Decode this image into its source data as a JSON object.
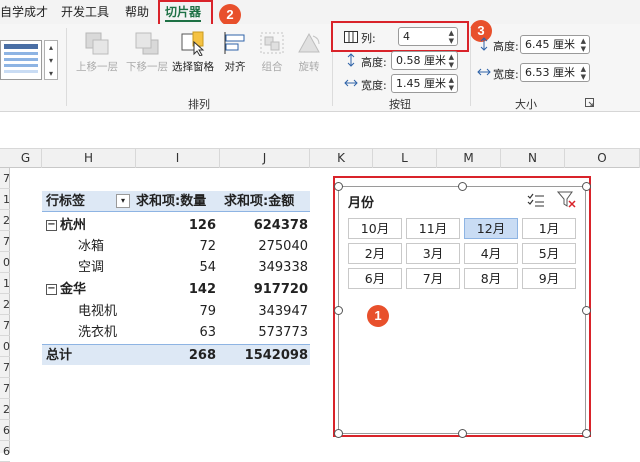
{
  "menu": {
    "tabs": [
      "自学成才",
      "开发工具",
      "帮助",
      "切片器"
    ],
    "active": "切片器"
  },
  "ribbon": {
    "arrange": {
      "label": "排列",
      "buttons": [
        "上移一层",
        "下移一层",
        "选择窗格",
        "对齐",
        "组合",
        "旋转"
      ]
    },
    "buttons_group": {
      "label": "按钮",
      "columns_label": "列:",
      "columns_value": "4",
      "height_label": "高度:",
      "height_value": "0.58 厘米",
      "width_label": "宽度:",
      "width_value": "1.45 厘米"
    },
    "size_group": {
      "label": "大小",
      "height_label": "高度:",
      "height_value": "6.45 厘米",
      "width_label": "宽度:",
      "width_value": "6.53 厘米"
    }
  },
  "sheet": {
    "columns": [
      "G",
      "H",
      "I",
      "J",
      "K",
      "L",
      "M",
      "N",
      "O"
    ],
    "rows": [
      "7",
      "1",
      "2",
      "7",
      "0",
      "1",
      "2",
      "7",
      "0",
      "7",
      "7",
      "2",
      "6",
      "6"
    ]
  },
  "pivot": {
    "header": {
      "label": "行标签",
      "col1": "求和项:数量",
      "col2": "求和项:金额"
    },
    "rows": [
      {
        "label": "杭州",
        "qty": "126",
        "amount": "624378",
        "level": 0
      },
      {
        "label": "冰箱",
        "qty": "72",
        "amount": "275040",
        "level": 1
      },
      {
        "label": "空调",
        "qty": "54",
        "amount": "349338",
        "level": 1
      },
      {
        "label": "金华",
        "qty": "142",
        "amount": "917720",
        "level": 0
      },
      {
        "label": "电视机",
        "qty": "79",
        "amount": "343947",
        "level": 1
      },
      {
        "label": "洗衣机",
        "qty": "63",
        "amount": "573773",
        "level": 1
      }
    ],
    "total": {
      "label": "总计",
      "qty": "268",
      "amount": "1542098"
    }
  },
  "slicer": {
    "title": "月份",
    "items": [
      "10月",
      "11月",
      "12月",
      "1月",
      "2月",
      "3月",
      "4月",
      "5月",
      "6月",
      "7月",
      "8月",
      "9月"
    ],
    "selected": "12月",
    "multiselect_icon": "multi-select-icon",
    "clear_filter_icon": "clear-filter-icon"
  },
  "badges": [
    "1",
    "2",
    "3"
  ],
  "colors": {
    "accent": "#1e7145",
    "highlight": "#d9232a",
    "badge": "#e8502c",
    "slicer_selected": "#c9dcf4",
    "pivot_header": "#dde8f5"
  }
}
